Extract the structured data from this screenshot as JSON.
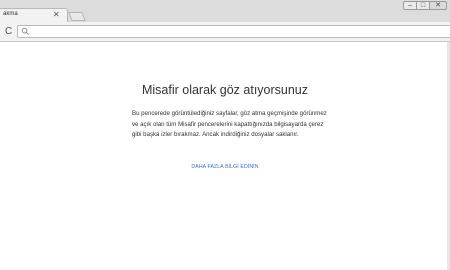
{
  "browser": {
    "tab_title": "akma",
    "tab_close": "✕",
    "window_controls": {
      "minimize": "–",
      "maximize": "□",
      "close": "✕"
    },
    "reload": "C",
    "omnibox_value": ""
  },
  "page": {
    "heading": "Misafir olarak göz atıyorsunuz",
    "body": "Bu pencerede görüntülediğiniz sayfalar, göz atma geçmişinde görünmez ve açık olan tüm Misafir pencerelerini kapattığınızda bilgisayarda çerez gibi başka izler bırakmaz. Ancak indirdiğiniz dosyalar saklanır.",
    "learn_more": "DAHA FAZLA BİLGİ EDİNİN"
  }
}
